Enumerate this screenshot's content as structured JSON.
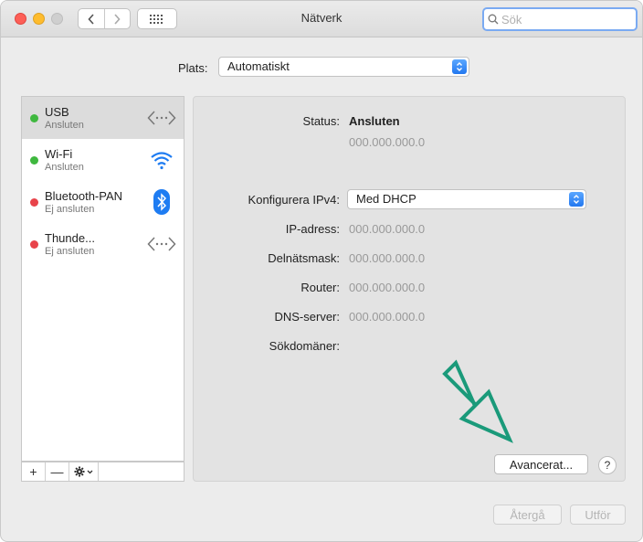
{
  "window": {
    "title": "Nätverk"
  },
  "search": {
    "placeholder": "Sök",
    "value": ""
  },
  "location": {
    "label": "Plats:",
    "value": "Automatiskt"
  },
  "services": [
    {
      "name": "USB",
      "status": "Ansluten",
      "status_color": "#3fb83f",
      "icon": "ethernet-icon",
      "selected": true
    },
    {
      "name": "Wi-Fi",
      "status": "Ansluten",
      "status_color": "#3fb83f",
      "icon": "wifi-icon",
      "selected": false
    },
    {
      "name": "Bluetooth-PAN",
      "status": "Ej ansluten",
      "status_color": "#e8434a",
      "icon": "bluetooth-icon",
      "selected": false
    },
    {
      "name": "Thunde...",
      "status": "Ej ansluten",
      "status_color": "#e8434a",
      "icon": "ethernet-icon",
      "selected": false
    }
  ],
  "sidebar_toolbar": {
    "add": "+",
    "remove": "—"
  },
  "detail": {
    "status_label": "Status:",
    "status_value": "Ansluten",
    "status_ip": "000.000.000.0",
    "config_label": "Konfigurera IPv4:",
    "config_value": "Med DHCP",
    "ip_label": "IP-adress:",
    "ip_value": "000.000.000.0",
    "subnet_label": "Delnätsmask:",
    "subnet_value": "000.000.000.0",
    "router_label": "Router:",
    "router_value": "000.000.000.0",
    "dns_label": "DNS-server:",
    "dns_value": "000.000.000.0",
    "search_domains_label": "Sökdomäner:",
    "advanced_button": "Avancerat...",
    "help_button": "?"
  },
  "footer": {
    "revert_button": "Återgå",
    "apply_button": "Utför"
  },
  "colors": {
    "accent": "#2277f0",
    "annotation_arrow": "#1a9a7a",
    "connected": "#3fb83f",
    "disconnected": "#e8434a"
  }
}
